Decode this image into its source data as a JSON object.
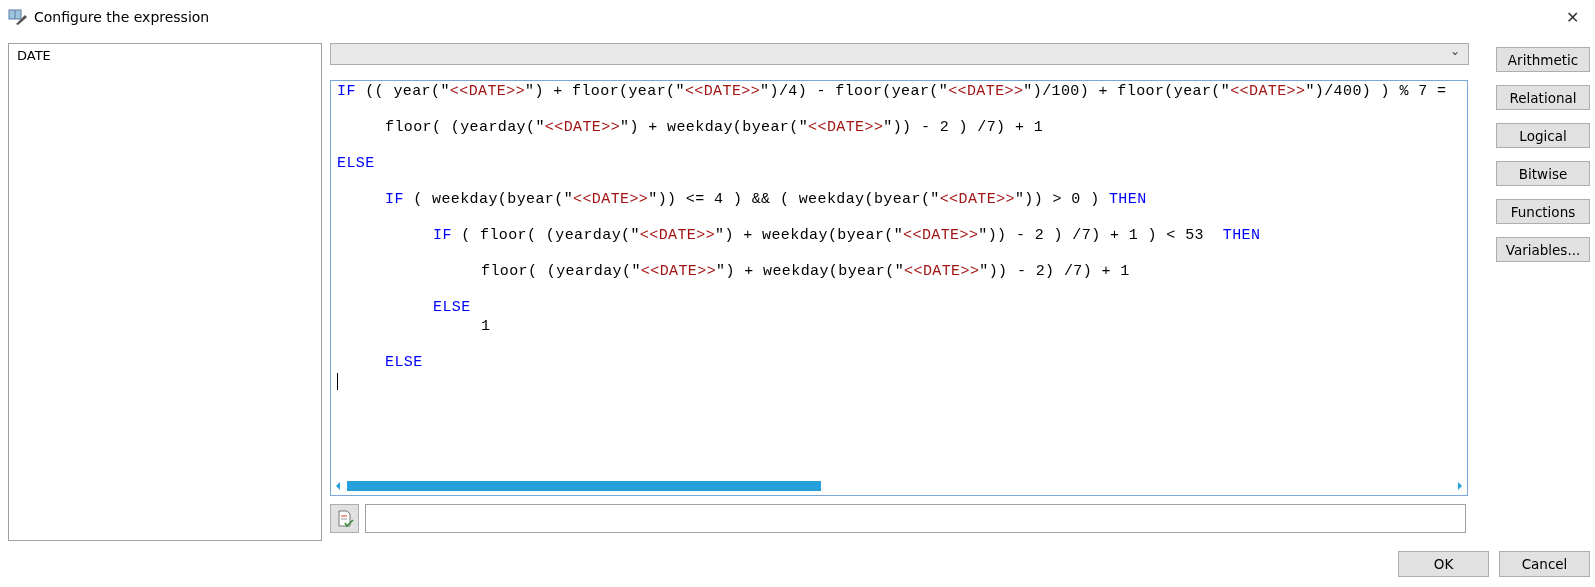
{
  "window": {
    "title": "Configure the expression",
    "close": "✕"
  },
  "variables": {
    "items": [
      {
        "label": "DATE",
        "selected": false
      }
    ]
  },
  "operator_dropdown": {
    "caret": "⌄"
  },
  "operator_buttons": [
    "Arithmetic",
    "Relational",
    "Logical",
    "Bitwise",
    "Functions",
    "Variables..."
  ],
  "editor": {
    "lines": [
      {
        "blank_line_after": true,
        "tokens": [
          {
            "kind": "keyword",
            "text": "IF"
          },
          {
            "kind": "plain",
            "text": " (( year(\""
          },
          {
            "kind": "string",
            "text": "<<DATE>>"
          },
          {
            "kind": "plain",
            "text": "\") + floor(year(\""
          },
          {
            "kind": "string",
            "text": "<<DATE>>"
          },
          {
            "kind": "plain",
            "text": "\")/4) - floor(year(\""
          },
          {
            "kind": "string",
            "text": "<<DATE>>"
          },
          {
            "kind": "plain",
            "text": "\")/100) + floor(year(\""
          },
          {
            "kind": "string",
            "text": "<<DATE>>"
          },
          {
            "kind": "plain",
            "text": "\")/400) ) % 7 ="
          }
        ],
        "children": [
          {
            "blank_line_after": true,
            "tokens": [
              {
                "kind": "plain",
                "text": "floor( (yearday(\""
              },
              {
                "kind": "string",
                "text": "<<DATE>>"
              },
              {
                "kind": "plain",
                "text": "\") + weekday(byear(\""
              },
              {
                "kind": "string",
                "text": "<<DATE>>"
              },
              {
                "kind": "plain",
                "text": "\")) - 2 ) /7) + 1"
              }
            ]
          }
        ]
      },
      {
        "blank_line_after": true,
        "tokens": [
          {
            "kind": "keyword",
            "text": "ELSE"
          }
        ],
        "children": [
          {
            "blank_line_after": true,
            "tokens": [
              {
                "kind": "keyword",
                "text": "IF"
              },
              {
                "kind": "plain",
                "text": " ( weekday(byear(\""
              },
              {
                "kind": "string",
                "text": "<<DATE>>"
              },
              {
                "kind": "plain",
                "text": "\")) <= 4 ) && ( weekday(byear(\""
              },
              {
                "kind": "string",
                "text": "<<DATE>>"
              },
              {
                "kind": "plain",
                "text": "\")) > 0 ) "
              },
              {
                "kind": "keyword",
                "text": "THEN"
              }
            ],
            "children": [
              {
                "blank_line_after": true,
                "tokens": [
                  {
                    "kind": "keyword",
                    "text": "IF"
                  },
                  {
                    "kind": "plain",
                    "text": " ( floor( (yearday(\""
                  },
                  {
                    "kind": "string",
                    "text": "<<DATE>>"
                  },
                  {
                    "kind": "plain",
                    "text": "\") + weekday(byear(\""
                  },
                  {
                    "kind": "string",
                    "text": "<<DATE>>"
                  },
                  {
                    "kind": "plain",
                    "text": "\")) - 2 ) /7) + 1 ) < 53  "
                  },
                  {
                    "kind": "keyword",
                    "text": "THEN"
                  }
                ],
                "children": [
                  {
                    "blank_line_after": true,
                    "tokens": [
                      {
                        "kind": "plain",
                        "text": "floor( (yearday(\""
                      },
                      {
                        "kind": "string",
                        "text": "<<DATE>>"
                      },
                      {
                        "kind": "plain",
                        "text": "\") + weekday(byear(\""
                      },
                      {
                        "kind": "string",
                        "text": "<<DATE>>"
                      },
                      {
                        "kind": "plain",
                        "text": "\")) - 2) /7) + 1"
                      }
                    ]
                  }
                ]
              },
              {
                "blank_line_after": false,
                "tokens": [
                  {
                    "kind": "keyword",
                    "text": "ELSE"
                  }
                ],
                "children": [
                  {
                    "blank_line_after": true,
                    "tokens": [
                      {
                        "kind": "plain",
                        "text": "1"
                      }
                    ]
                  }
                ]
              }
            ]
          },
          {
            "blank_line_after": false,
            "tokens": [
              {
                "kind": "keyword",
                "text": "ELSE"
              }
            ]
          }
        ]
      }
    ]
  },
  "footer_buttons": [
    "OK",
    "Cancel"
  ]
}
